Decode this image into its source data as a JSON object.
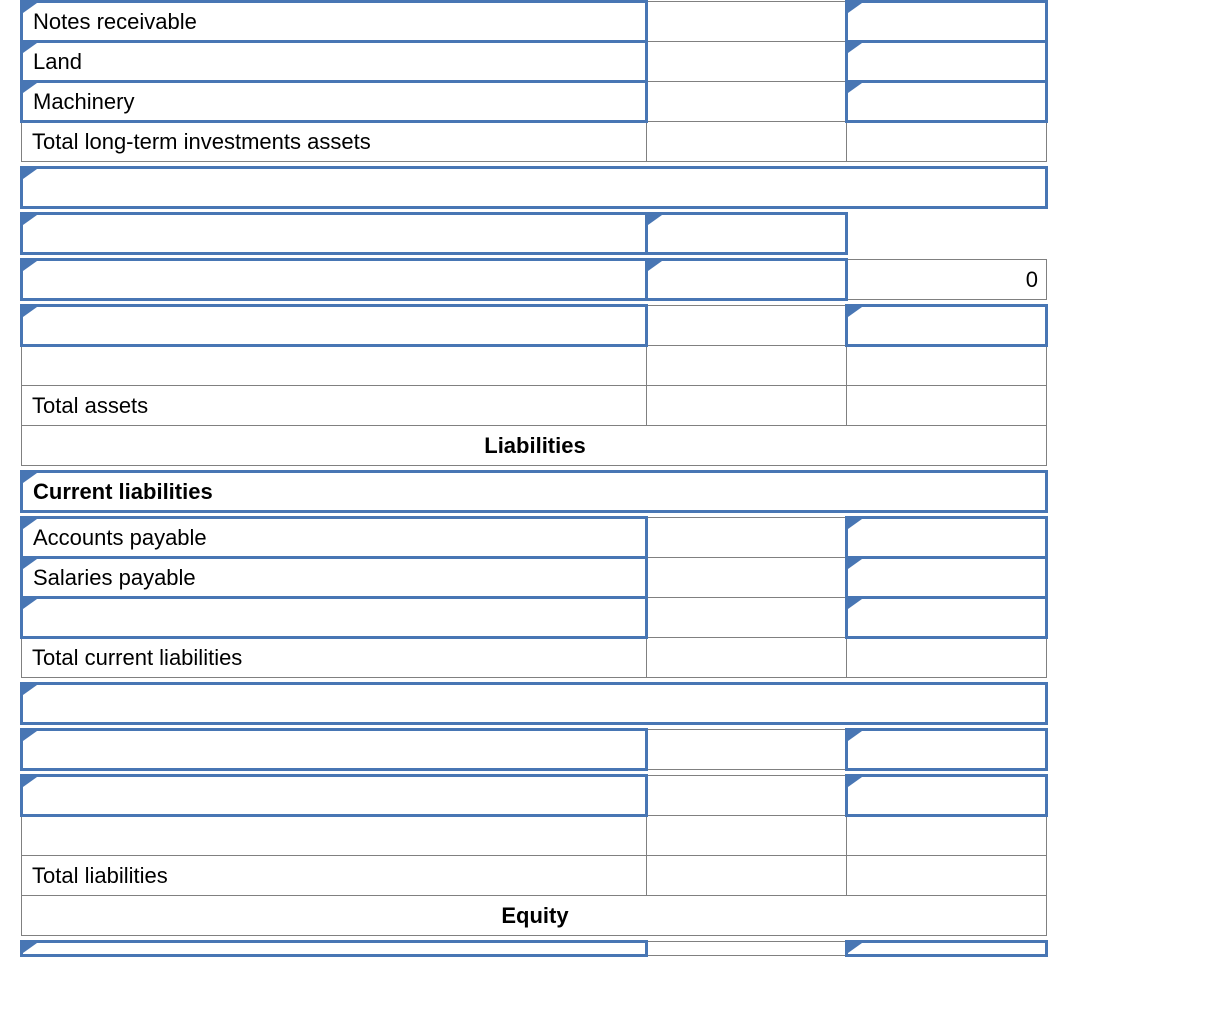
{
  "assets": {
    "notes_receivable": "Notes receivable",
    "land": "Land",
    "machinery": "Machinery",
    "total_lti": "Total long-term investments assets",
    "zero": "0",
    "total_assets": "Total assets"
  },
  "liabilities": {
    "heading": "Liabilities",
    "current_heading": "Current liabilities",
    "accounts_payable": "Accounts payable",
    "salaries_payable": "Salaries payable",
    "total_current": "Total current liabilities",
    "total_liabilities": "Total liabilities"
  },
  "equity": {
    "heading": "Equity"
  }
}
